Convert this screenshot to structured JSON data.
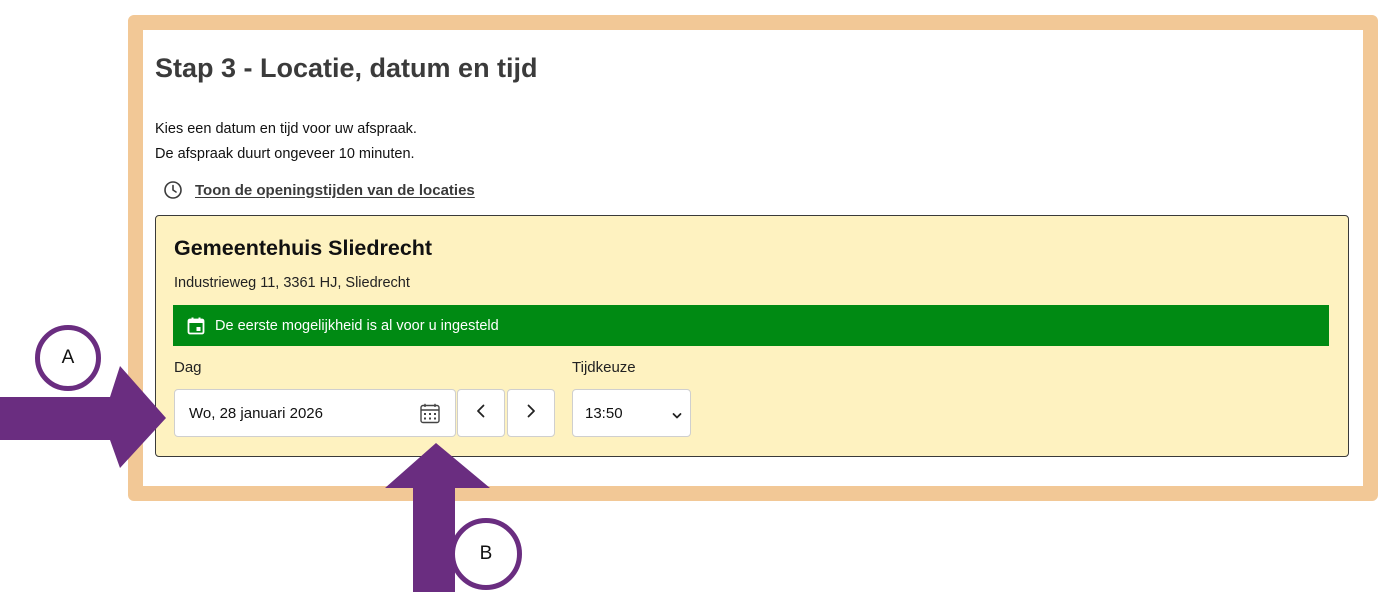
{
  "page": {
    "title": "Stap 3 - Locatie, datum en tijd",
    "intro_line1": "Kies een datum en tijd voor uw afspraak.",
    "intro_line2": "De afspraak duurt ongeveer 10 minuten.",
    "hours_link": {
      "label": "Toon de openingstijden van de locaties",
      "icon": "clock-icon"
    }
  },
  "location": {
    "name": "Gemeentehuis Sliedrecht",
    "address": "Industrieweg 11, 3361 HJ, Sliedrecht",
    "notice": {
      "text": "De eerste mogelijkheid is al voor u ingesteld",
      "icon": "calendar-icon"
    },
    "day": {
      "label": "Dag",
      "value": "Wo, 28 januari 2026",
      "picker_icon": "calendar-grid-icon",
      "prev_icon": "chevron-left-icon",
      "next_icon": "chevron-right-icon"
    },
    "time": {
      "label": "Tijdkeuze",
      "value": "13:50",
      "dropdown_icon": "chevron-down-icon"
    }
  },
  "annotations": {
    "callout_a": "A",
    "callout_b": "B"
  },
  "colors": {
    "frame_border": "#f2c896",
    "card_background": "#fef2c0",
    "notice_background": "#008a13",
    "annotation_purple": "#6a2d80"
  }
}
